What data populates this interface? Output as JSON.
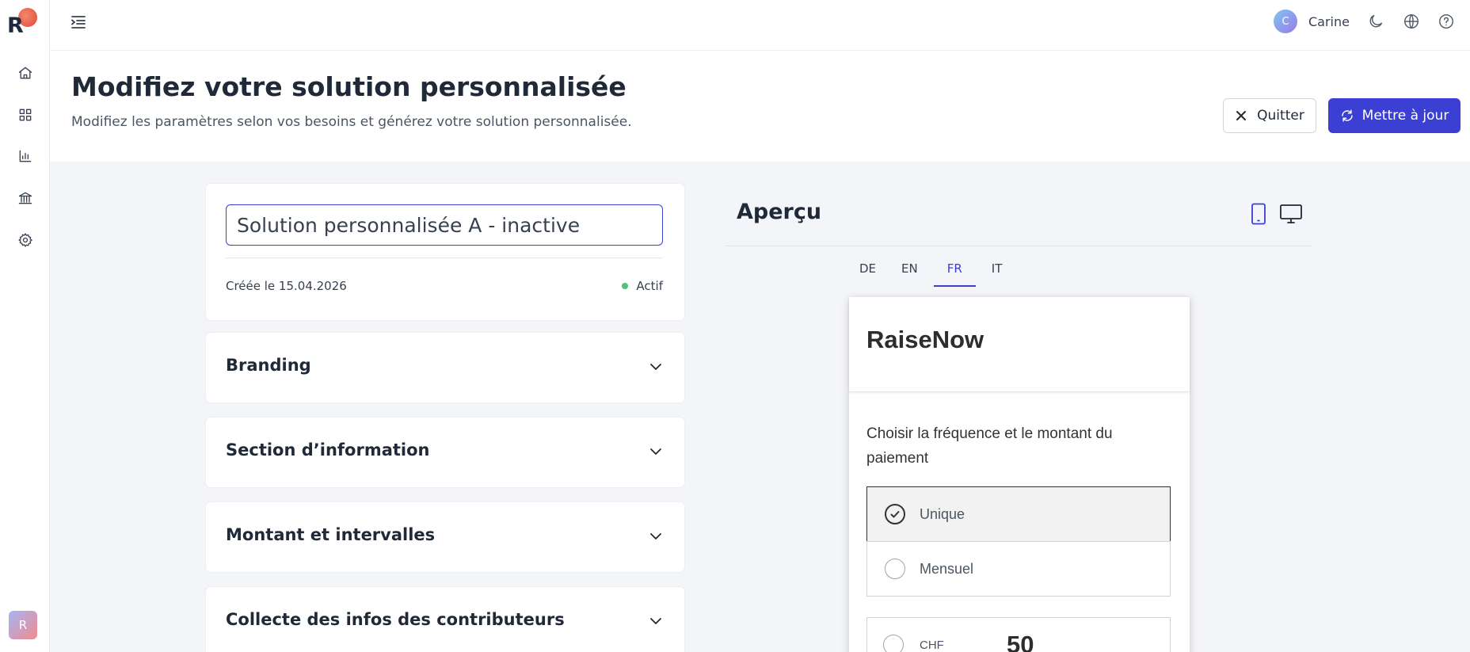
{
  "app": {
    "logo_letter": "R"
  },
  "sidebar": {
    "items": [
      {
        "icon": "home-icon",
        "label": "Home"
      },
      {
        "icon": "grid-icon",
        "label": "Solutions"
      },
      {
        "icon": "bar-chart-icon",
        "label": "Analytics"
      },
      {
        "icon": "bank-icon",
        "label": "Payouts"
      },
      {
        "icon": "gear-icon",
        "label": "Settings"
      }
    ],
    "account_initial": "R"
  },
  "topbar": {
    "user_initial": "C",
    "user_name": "Carine",
    "icons": [
      "moon-icon",
      "globe-icon",
      "help-icon"
    ]
  },
  "header": {
    "title": "Modifiez votre solution personnalisée",
    "subtitle": "Modifiez les paramètres selon vos besoins et générez votre solution personnalisée.",
    "quit_label": "Quitter",
    "update_label": "Mettre à jour"
  },
  "solution": {
    "name": "Solution personnalisée A - inactive",
    "created": "Créée le 15.04.2026",
    "status": "Actif",
    "status_color": "#4cc27a"
  },
  "sections": [
    {
      "title": "Branding"
    },
    {
      "title": "Section d’information"
    },
    {
      "title": "Montant et intervalles"
    },
    {
      "title": "Collecte des infos des contributeurs"
    }
  ],
  "preview": {
    "title": "Aperçu",
    "devices": [
      "mobile-icon",
      "desktop-icon"
    ],
    "active_device": "mobile",
    "languages": [
      "DE",
      "EN",
      "FR",
      "IT"
    ],
    "active_language": "FR",
    "form": {
      "brand": "RaiseNow",
      "question": "Choisir la fréquence et le montant du paiement",
      "frequencies": [
        {
          "label": "Unique",
          "selected": true
        },
        {
          "label": "Mensuel",
          "selected": false
        }
      ],
      "currency": "CHF",
      "amount": "50"
    }
  },
  "colors": {
    "accent": "#3b3fd4",
    "background": "#f4f5f9"
  }
}
